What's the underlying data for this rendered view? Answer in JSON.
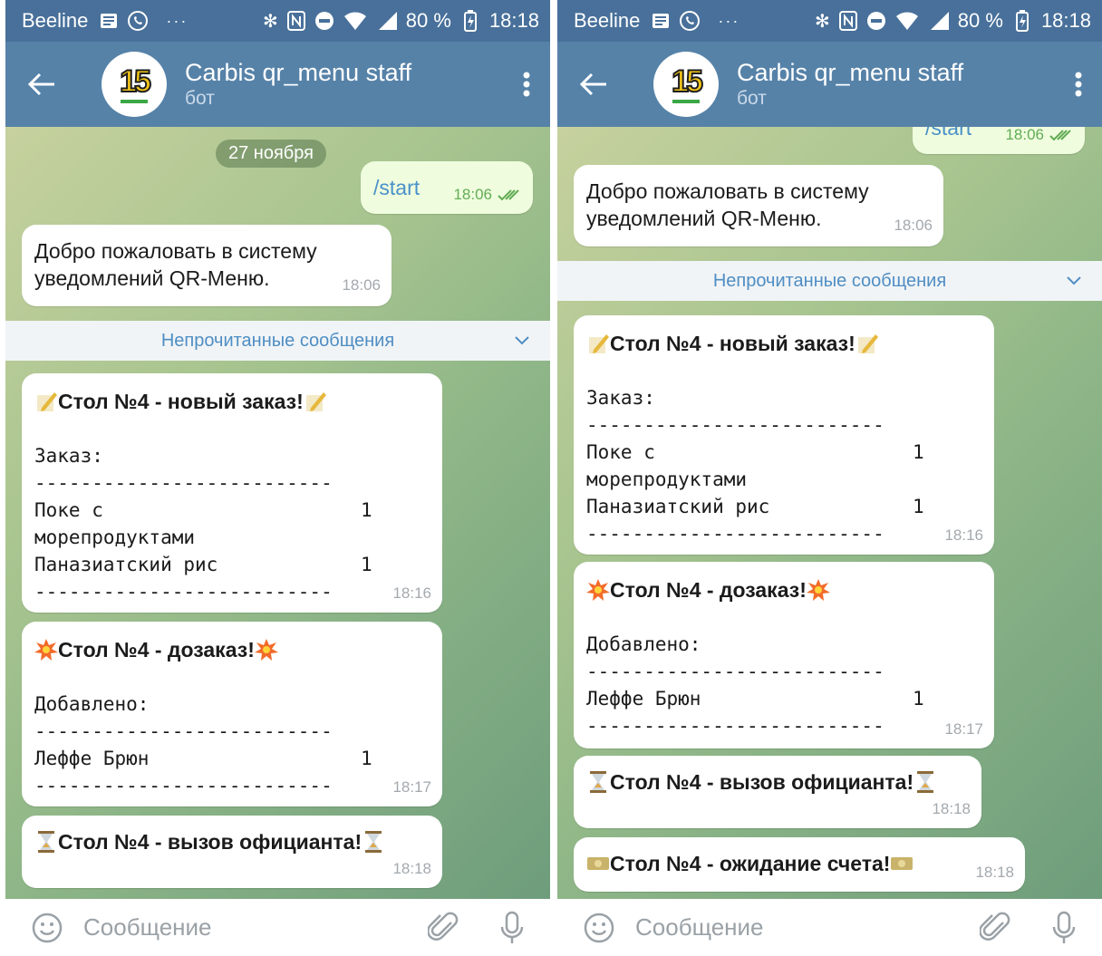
{
  "colors": {
    "status_bar": "#48709a",
    "app_bar": "#5682a8",
    "outgoing_bubble": "#effdde",
    "incoming_bubble": "#ffffff",
    "unread_text": "#4f8ec4",
    "checkmark": "#62ac55"
  },
  "status": {
    "carrier": "Beeline",
    "battery": "80 %",
    "time": "18:18",
    "icons": [
      "news-icon",
      "whatsapp-icon",
      "more-dots-icon",
      "bluetooth-icon",
      "nfc-icon",
      "dnd-icon",
      "wifi-icon",
      "signal-icon",
      "battery-charging-icon"
    ]
  },
  "header": {
    "title": "Carbis qr_menu staff",
    "subtitle": "бот",
    "avatar_text": "15"
  },
  "chat": {
    "date": "27 ноября",
    "start_command": "/start",
    "start_time": "18:06",
    "welcome_line1": "Добро пожаловать в систему",
    "welcome_line2": "уведомлений QR-Меню.",
    "welcome_time": "18:06",
    "unread_label": "Непрочитанные сообщения",
    "order": {
      "title": "Стол №4 - новый заказ!",
      "label": "Заказ:",
      "divider": "--------------------------",
      "item1_line1": "Поке с",
      "item1_qty": "1",
      "item1_line2": "морепродуктами",
      "item2_name": "Паназиатский рис",
      "item2_qty": "1",
      "time": "18:16"
    },
    "addon": {
      "title": "Стол №4 - дозаказ!",
      "label": "Добавлено:",
      "item_name": "Леффе Брюн",
      "item_qty": "1",
      "time": "18:17"
    },
    "waiter": {
      "title": "Стол №4 - вызов официанта!",
      "time": "18:18"
    },
    "bill": {
      "title": "Стол №4 - ожидание счета!",
      "time": "18:18"
    }
  },
  "input": {
    "placeholder": "Сообщение"
  }
}
